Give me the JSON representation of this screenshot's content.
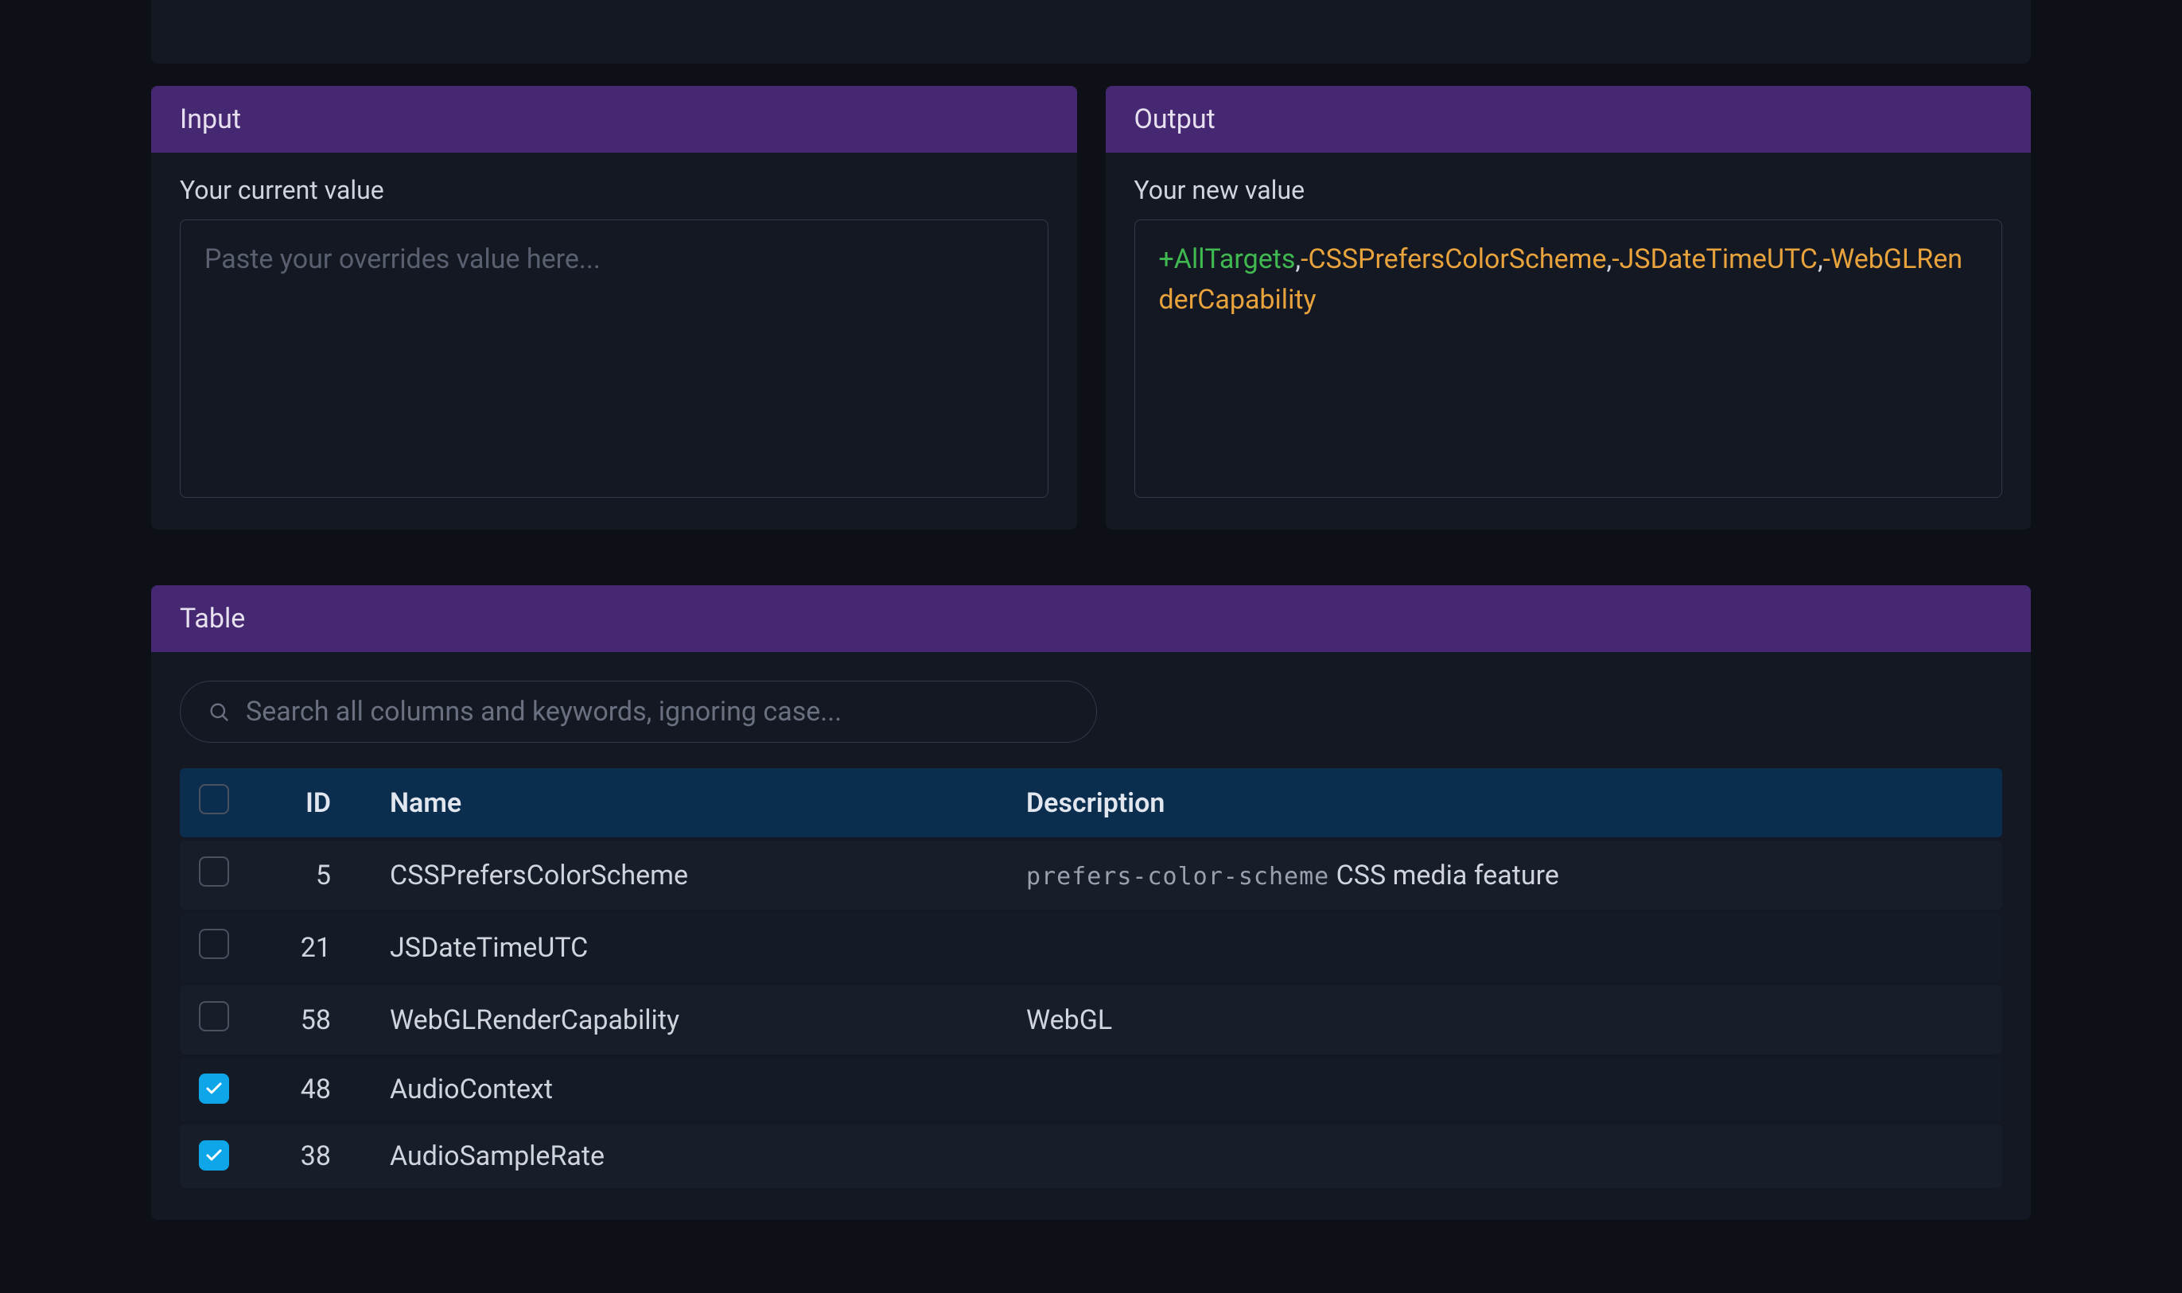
{
  "prev_card_strip": true,
  "input_card": {
    "title": "Input",
    "label": "Your current value",
    "placeholder": "Paste your overrides value here...",
    "value": ""
  },
  "output_card": {
    "title": "Output",
    "label": "Your new value",
    "tokens": [
      {
        "text": "+AllTargets",
        "cls": "tok-green"
      },
      {
        "text": ",",
        "cls": "tok-sep"
      },
      {
        "text": "-CSSPrefersColorScheme",
        "cls": "tok-orange"
      },
      {
        "text": ",",
        "cls": "tok-sep"
      },
      {
        "text": "-JSDateTimeUTC",
        "cls": "tok-orange"
      },
      {
        "text": ",",
        "cls": "tok-sep"
      },
      {
        "text": "-WebGLRenderCapability",
        "cls": "tok-orange"
      }
    ]
  },
  "table_card": {
    "title": "Table",
    "search_placeholder": "Search all columns and keywords, ignoring case...",
    "columns": {
      "id": "ID",
      "name": "Name",
      "description": "Description"
    },
    "header_checkbox": false,
    "rows": [
      {
        "checked": false,
        "id": "5",
        "name": "CSSPrefersColorScheme",
        "desc_code": "prefers-color-scheme",
        "desc_text": " CSS media feature"
      },
      {
        "checked": false,
        "id": "21",
        "name": "JSDateTimeUTC",
        "desc_code": "",
        "desc_text": ""
      },
      {
        "checked": false,
        "id": "58",
        "name": "WebGLRenderCapability",
        "desc_code": "",
        "desc_text": "WebGL"
      },
      {
        "checked": true,
        "id": "48",
        "name": "AudioContext",
        "desc_code": "",
        "desc_text": ""
      },
      {
        "checked": true,
        "id": "38",
        "name": "AudioSampleRate",
        "desc_code": "",
        "desc_text": ""
      }
    ]
  }
}
